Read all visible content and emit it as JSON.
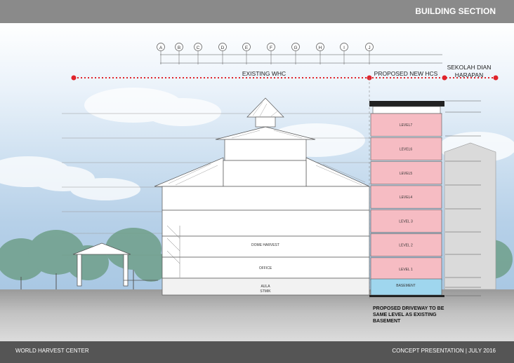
{
  "header": {
    "title": "BUILDING SECTION"
  },
  "footer": {
    "left": "WORLD HARVEST CENTER",
    "right": "CONCEPT PRESENTATION | JULY 2016"
  },
  "grid_labels": [
    "A",
    "B",
    "C",
    "D",
    "E",
    "F",
    "G",
    "H",
    "I",
    "J"
  ],
  "zones": {
    "existing": "EXISTING WHC",
    "proposed": "PROPOSED NEW HCS",
    "school": [
      "SEKOLAH DIAN",
      "HARAPAN"
    ]
  },
  "levels": [
    "LEVEL7",
    "LEVEL6",
    "LEVEL5",
    "LEVEL4",
    "LEVEL 3",
    "LEVEL 2",
    "LEVEL 1"
  ],
  "basement": "BASEMENT",
  "existing_rooms": {
    "dome": "DOME HARVEST",
    "office": "OFFICE",
    "aula": [
      "AULA",
      "STMIK"
    ]
  },
  "note": "PROPOSED DRIVEWAY TO BE SAME LEVEL AS EXISTING BASEMENT",
  "colors": {
    "level_fill": "#f6bcc3",
    "basement_fill": "#9fd6ee",
    "dash_red": "#e0242b"
  }
}
